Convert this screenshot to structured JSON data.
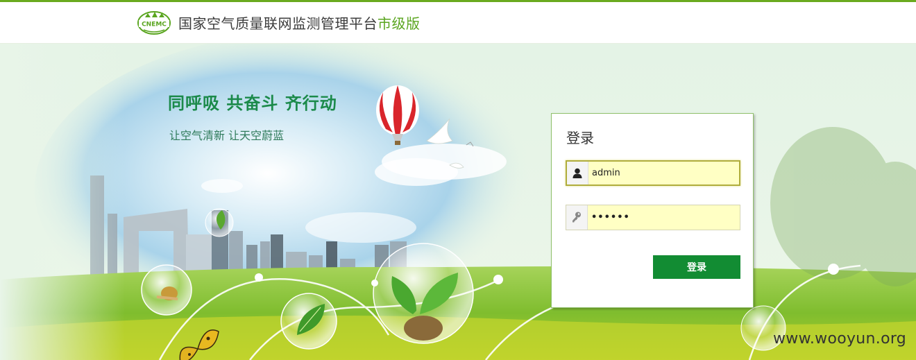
{
  "header": {
    "logo_text": "CNEMC",
    "title": "国家空气质量联网监测管理平台",
    "edition": "市级版"
  },
  "hero": {
    "slogan_main": "同呼吸  共奋斗  齐行动",
    "slogan_sub": "让空气清新  让天空蔚蓝"
  },
  "login": {
    "title": "登录",
    "username_value": "admin",
    "password_value": "••••••",
    "username_icon": "user-icon",
    "password_icon": "key-icon",
    "submit_label": "登录"
  },
  "watermark": "www.wooyun.org",
  "colors": {
    "accent_green": "#6aaa1f",
    "button_green": "#128c33",
    "slogan_green": "#1b8a4a",
    "input_bg": "#ffffc4"
  }
}
